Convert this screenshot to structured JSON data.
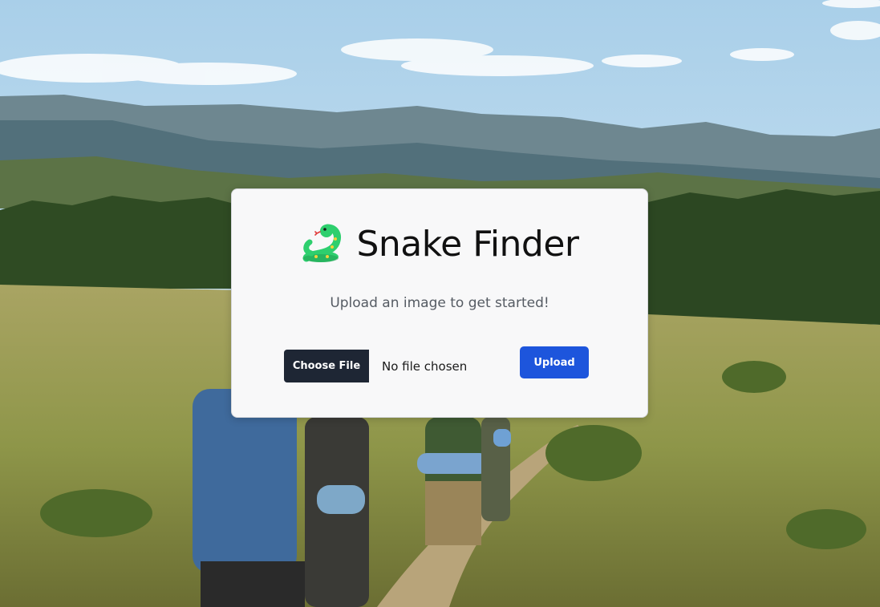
{
  "app": {
    "title": "Snake Finder",
    "subtitle": "Upload an image to get started!",
    "logo_icon": "snake-icon"
  },
  "upload_form": {
    "choose_file_label": "Choose File",
    "file_status": "No file chosen",
    "upload_label": "Upload"
  },
  "colors": {
    "primary_button": "#1d55dc",
    "file_button": "#1e2634",
    "snake_green": "#2ecf6e",
    "snake_dark": "#1f9b4f",
    "snake_spots": "#f3d33a"
  }
}
